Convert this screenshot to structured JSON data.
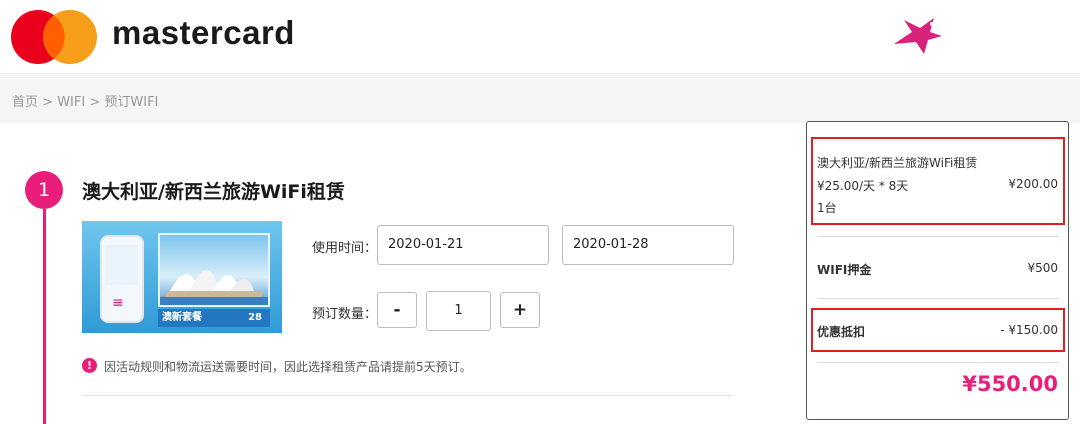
{
  "brand": {
    "name": "mastercard",
    "colors": {
      "red": "#eb001b",
      "orange": "#f79e1b",
      "overlap": "#ff5f00",
      "accent": "#e91e7a"
    },
    "right_icon": "flying-squirrel-logo-icon"
  },
  "breadcrumb": [
    "首页",
    ">",
    "WIFI",
    ">",
    "预订WIFI"
  ],
  "step": {
    "number": "1",
    "title": "澳大利亚/新西兰旅游WiFi租赁"
  },
  "product_image": {
    "banner_text": "澳新套餐",
    "price_badge": "28",
    "icon": "wifi-icon"
  },
  "booking": {
    "date_label": "使用时间：",
    "start_date": "2020-01-21",
    "end_date": "2020-01-28",
    "qty_label": "预订数量：",
    "minus": "-",
    "quantity": "1",
    "plus": "+"
  },
  "notice": {
    "icon": "!",
    "text": "因活动规则和物流运送需要时间，因此选择租赁产品请提前5天预订。"
  },
  "summary": {
    "item_name": "澳大利亚/新西兰旅游WiFi租赁",
    "rate": "¥25.00/天 * 8天",
    "rate_total": "¥200.00",
    "units": "1台",
    "deposit_label": "WIFI押金",
    "deposit_value": "¥500",
    "discount_label": "优惠抵扣",
    "discount_value": "- ¥150.00",
    "total": "¥550.00"
  }
}
